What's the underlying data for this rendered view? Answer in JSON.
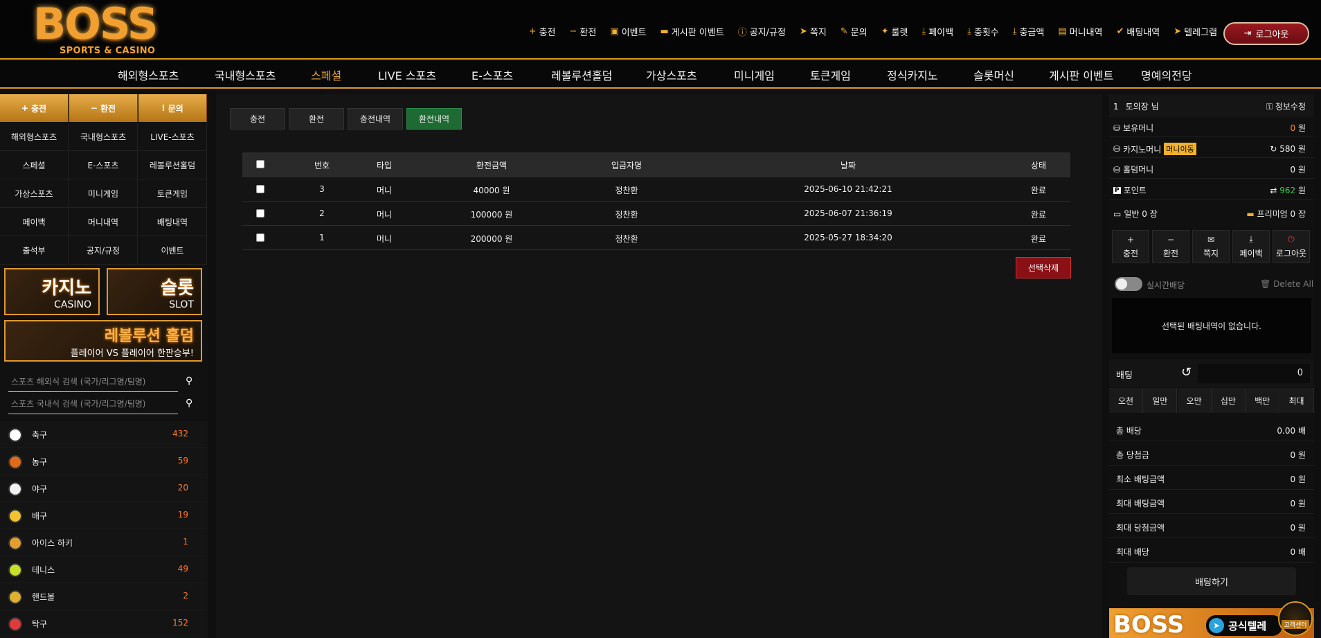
{
  "logo": {
    "main": "BOSS",
    "sub": "SPORTS & CASINO"
  },
  "top_menu": [
    {
      "icon": "plus-icon",
      "glyph": "+",
      "label": "충전"
    },
    {
      "icon": "minus-icon",
      "glyph": "−",
      "label": "환전"
    },
    {
      "icon": "calendar-icon",
      "glyph": "▣",
      "label": "이벤트"
    },
    {
      "icon": "board-event-icon",
      "glyph": "▬",
      "label": "게시판 이벤트"
    },
    {
      "icon": "info-icon",
      "glyph": "ⓘ",
      "label": "공지/규정"
    },
    {
      "icon": "paper-plane-icon",
      "glyph": "➤",
      "label": "쪽지"
    },
    {
      "icon": "edit-icon",
      "glyph": "✎",
      "label": "문의"
    },
    {
      "icon": "gift-icon",
      "glyph": "✦",
      "label": "룰렛"
    },
    {
      "icon": "payback-icon",
      "glyph": "⤓",
      "label": "페이백"
    },
    {
      "icon": "hand-coin-icon",
      "glyph": "⤓",
      "label": "충횟수"
    },
    {
      "icon": "hand-coin-icon",
      "glyph": "⤓",
      "label": "충금액"
    },
    {
      "icon": "clipboard-icon",
      "glyph": "▤",
      "label": "머니내역"
    },
    {
      "icon": "check-icon",
      "glyph": "✔",
      "label": "배팅내역"
    },
    {
      "icon": "telegram-icon",
      "glyph": "➤",
      "label": "텔레그램"
    }
  ],
  "logout_top": "로그아웃",
  "main_nav": [
    "해외형스포츠",
    "국내형스포츠",
    "스페셜",
    "LIVE 스포츠",
    "E-스포츠",
    "레볼루션홀덤",
    "가상스포츠",
    "미니게임",
    "토큰게임",
    "정식카지노",
    "슬롯머신",
    "게시판 이벤트",
    "명예의전당"
  ],
  "main_nav_active": "스페셜",
  "left": {
    "top_buttons": [
      {
        "glyph": "+",
        "label": "충전"
      },
      {
        "glyph": "−",
        "label": "환전"
      },
      {
        "glyph": "!",
        "label": "문의"
      }
    ],
    "grid": [
      "해외형스포츠",
      "국내형스포츠",
      "LIVE-스포츠",
      "스페셜",
      "E-스포츠",
      "레볼루션홀덤",
      "가상스포츠",
      "미니게임",
      "토큰게임",
      "페이백",
      "머니내역",
      "배팅내역",
      "출석부",
      "공지/규정",
      "이벤트"
    ],
    "banner_casino": {
      "title": "카지노",
      "sub": "CASINO"
    },
    "banner_slot": {
      "title": "슬롯",
      "sub": "SLOT"
    },
    "banner_holdem": {
      "title": "레볼루션 홀덤",
      "sub": "플레이어 VS 플레이어 한판승부!"
    },
    "search_overseas_placeholder": "스포츠 해외식 검색 (국가/리그명/팀명)",
    "search_domestic_placeholder": "스포츠 국내식 검색 (국가/리그명/팀명)",
    "sports": [
      {
        "name": "축구",
        "count": "432",
        "color": "#ffffff"
      },
      {
        "name": "농구",
        "count": "59",
        "color": "#e06a1a"
      },
      {
        "name": "야구",
        "count": "20",
        "color": "#f2f2f2"
      },
      {
        "name": "배구",
        "count": "19",
        "color": "#f2c230"
      },
      {
        "name": "아이스 하키",
        "count": "1",
        "color": "#e0a030"
      },
      {
        "name": "테니스",
        "count": "49",
        "color": "#c8e02a"
      },
      {
        "name": "핸드볼",
        "count": "2",
        "color": "#e0b030"
      },
      {
        "name": "탁구",
        "count": "152",
        "color": "#e03a3a"
      }
    ]
  },
  "tabs": [
    {
      "label": "충전",
      "active": false
    },
    {
      "label": "환전",
      "active": false
    },
    {
      "label": "충전내역",
      "active": false
    },
    {
      "label": "환전내역",
      "active": true
    }
  ],
  "table": {
    "headers": [
      "번호",
      "타입",
      "환전금액",
      "입금자명",
      "날짜",
      "상태"
    ],
    "rows": [
      [
        "3",
        "머니",
        "40000 원",
        "정찬환",
        "2025-06-10 21:42:21",
        "완료"
      ],
      [
        "2",
        "머니",
        "100000 원",
        "정찬환",
        "2025-06-07 21:36:19",
        "완료"
      ],
      [
        "1",
        "머니",
        "200000 원",
        "정찬환",
        "2025-05-27 18:34:20",
        "완료"
      ]
    ],
    "delete_button": "선택삭제"
  },
  "right": {
    "user_level": "1",
    "user_name": "토의장 님",
    "edit_info": "정보수정",
    "money_label": "보유머니",
    "money_value": "0",
    "casino_label": "카지노머니",
    "casino_move": "머니이동",
    "casino_value": "580 원",
    "holdem_label": "홀덤머니",
    "holdem_value": "0 원",
    "point_label": "포인트",
    "point_value": "962",
    "won": "원",
    "normal_ticket": "일반 0 장",
    "premium_ticket": "프리미엄 0 장",
    "quick": [
      {
        "glyph": "+",
        "label": "충전"
      },
      {
        "glyph": "−",
        "label": "환전"
      },
      {
        "glyph": "✉",
        "label": "쪽지"
      },
      {
        "glyph": "⤓",
        "label": "페이백"
      },
      {
        "glyph": "⏻",
        "label": "로그아웃"
      }
    ],
    "realtime_label": "실시간배당",
    "delete_all": "Delete All",
    "empty_bet": "선택된 배팅내역이 없습니다.",
    "bet_label": "배팅",
    "bet_value": "0",
    "amount_buttons": [
      "오천",
      "일만",
      "오만",
      "십만",
      "백만",
      "최대"
    ],
    "summary": [
      {
        "label": "총 배당",
        "value": "0.00 배"
      },
      {
        "label": "총 당첨금",
        "value": "0 원"
      },
      {
        "label": "최소 배팅금액",
        "value": "0 원"
      },
      {
        "label": "최대 배팅금액",
        "value": "0 원"
      },
      {
        "label": "최대 당첨금액",
        "value": "0 원"
      },
      {
        "label": "최대 배당",
        "value": "0 배"
      }
    ],
    "bet_button": "배팅하기",
    "bottom_banner": "BOSS",
    "telegram_banner": "공식텔레",
    "support_badge": "고객센터"
  },
  "colors": {
    "accent": "#d99a1e",
    "active_tab": "#1d6b33",
    "danger": "#8a1016",
    "count": "#ff7a2a",
    "point": "#3ccf4e",
    "money": "#ff8c1a"
  }
}
